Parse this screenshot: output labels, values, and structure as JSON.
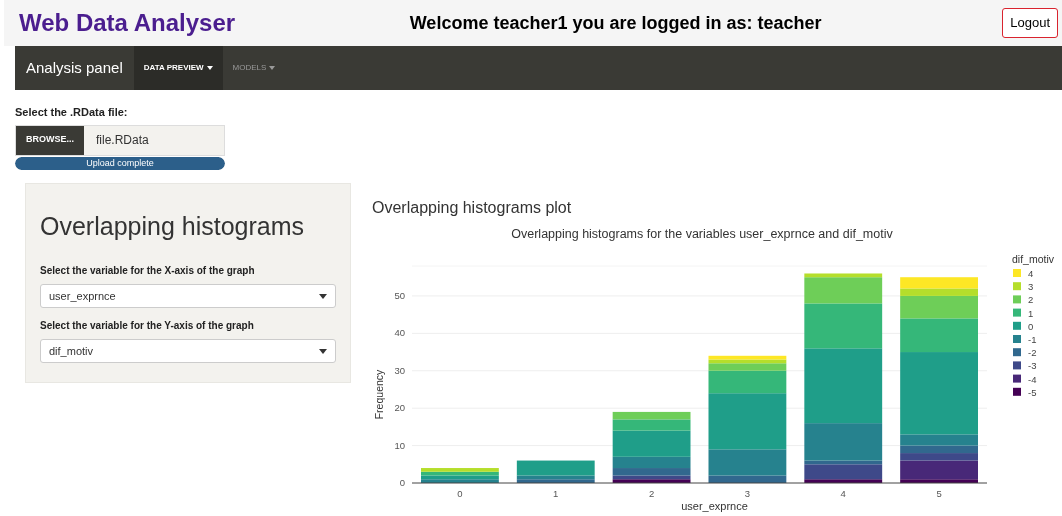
{
  "header": {
    "title": "Web Data Analyser",
    "welcome": "Welcome teacher1 you are logged in as: teacher",
    "logout": "Logout"
  },
  "navbar": {
    "brand": "Analysis panel",
    "menus": [
      {
        "label": "DATA PREVIEW",
        "selected": true
      },
      {
        "label": "MODELS",
        "selected": false
      }
    ]
  },
  "file_input": {
    "label": "Select the .RData file:",
    "button": "BROWSE...",
    "value": "file.RData",
    "progress": {
      "level": 1,
      "text": "Upload complete"
    }
  },
  "panel": {
    "heading": "Overlapping histograms",
    "fields": [
      {
        "label": "Select the variable for the X-axis of the graph",
        "value": "user_exprnce"
      },
      {
        "label": "Select the variable for the Y-axis of the graph",
        "value": "dif_motiv"
      }
    ]
  },
  "plot": {
    "heading": "Overlapping histograms plot",
    "chart_data": {
      "type": "bar",
      "stacked": true,
      "title": "Overlapping histograms for the variables user_exprnce and dif_motiv",
      "xlabel": "user_exprnce",
      "ylabel": "Frequency",
      "legend_title": "dif_motiv",
      "categories": [
        "0",
        "1",
        "2",
        "3",
        "4",
        "5"
      ],
      "grid": true,
      "legend": true,
      "ylim": [
        0,
        58
      ],
      "yticks": [
        0,
        10,
        20,
        30,
        40,
        50
      ],
      "series": [
        {
          "name": "-5",
          "color": "#440154",
          "values": [
            0,
            0,
            1,
            0,
            1,
            1
          ]
        },
        {
          "name": "-4",
          "color": "#482878",
          "values": [
            0,
            0,
            0,
            0,
            0,
            5
          ]
        },
        {
          "name": "-3",
          "color": "#3e4989",
          "values": [
            0,
            0,
            1,
            0,
            4,
            2
          ]
        },
        {
          "name": "-2",
          "color": "#31688e",
          "values": [
            0,
            1,
            2,
            2,
            1,
            2
          ]
        },
        {
          "name": "-1",
          "color": "#26828e",
          "values": [
            1,
            1,
            3,
            7,
            10,
            3
          ]
        },
        {
          "name": "0",
          "color": "#1f9e89",
          "values": [
            1,
            4,
            7,
            15,
            20,
            22
          ]
        },
        {
          "name": "1",
          "color": "#35b779",
          "values": [
            1,
            0,
            3,
            6,
            12,
            9
          ]
        },
        {
          "name": "2",
          "color": "#6ece58",
          "values": [
            0,
            0,
            2,
            2,
            7,
            6
          ]
        },
        {
          "name": "3",
          "color": "#b5de2b",
          "values": [
            1,
            0,
            0,
            1,
            1,
            2
          ]
        },
        {
          "name": "4",
          "color": "#fde725",
          "values": [
            0,
            0,
            0,
            1,
            0,
            3
          ]
        }
      ]
    }
  }
}
